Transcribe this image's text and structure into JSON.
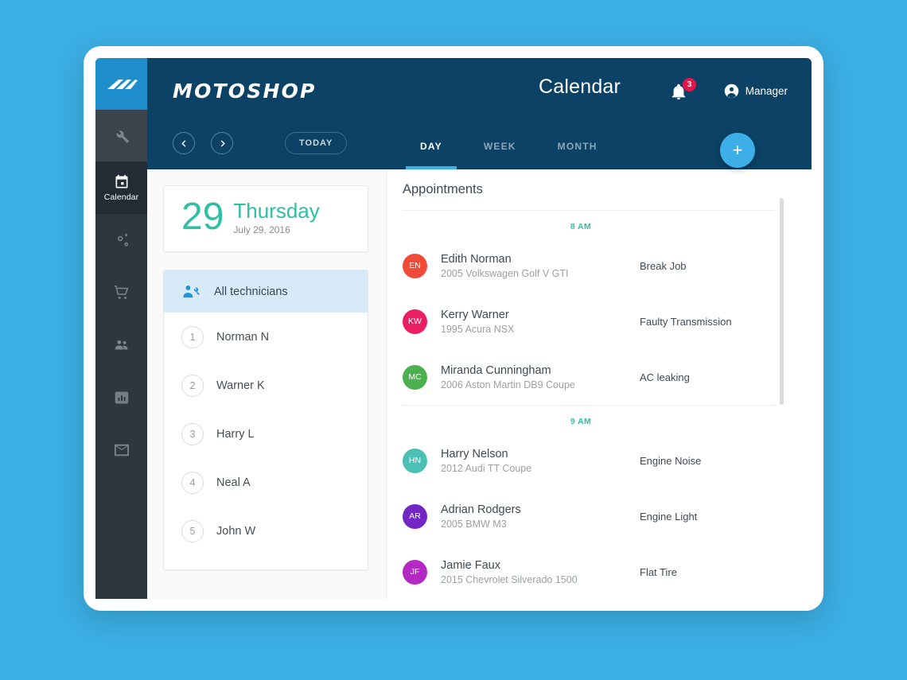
{
  "theme": {
    "page_background": "#3BAEE3",
    "header_background": "#0C4266",
    "rail_background": "#2C3740",
    "accent_blue": "#3CAEE8",
    "accent_teal": "#2EBFA5",
    "badge_red": "#E8154A",
    "selected_row": "#D6EAF7"
  },
  "brand": {
    "name": "MOTOSHOP",
    "logo_icon": "motoshop-logo-icon"
  },
  "header": {
    "title": "Calendar",
    "notifications": {
      "icon": "bell-icon",
      "count": "3"
    },
    "user": {
      "icon": "user-avatar-icon",
      "label": "Manager"
    }
  },
  "navbar": {
    "prev_icon": "chevron-left-icon",
    "next_icon": "chevron-right-icon",
    "today_label": "TODAY",
    "tabs": [
      {
        "label": "DAY",
        "active": true
      },
      {
        "label": "WEEK",
        "active": false
      },
      {
        "label": "MONTH",
        "active": false
      }
    ],
    "add_label": "+"
  },
  "rail": {
    "items": [
      {
        "icon": "wrench-icon",
        "label": "",
        "state": "hover"
      },
      {
        "icon": "calendar-icon",
        "label": "Calendar",
        "state": "active"
      },
      {
        "icon": "gears-icon",
        "label": "",
        "state": "normal"
      },
      {
        "icon": "shopping-cart-icon",
        "label": "",
        "state": "normal"
      },
      {
        "icon": "people-icon",
        "label": "",
        "state": "normal"
      },
      {
        "icon": "bar-chart-icon",
        "label": "",
        "state": "normal"
      },
      {
        "icon": "mail-icon",
        "label": "",
        "state": "normal"
      }
    ]
  },
  "date_card": {
    "day_number": "29",
    "day_name": "Thursday",
    "full_date": "July 29, 2016"
  },
  "technicians": {
    "all_label": "All technicians",
    "all_icon": "technician-icon",
    "list": [
      {
        "number": "1",
        "name": "Norman N"
      },
      {
        "number": "2",
        "name": "Warner K"
      },
      {
        "number": "3",
        "name": "Harry L"
      },
      {
        "number": "4",
        "name": "Neal A"
      },
      {
        "number": "5",
        "name": "John W"
      }
    ]
  },
  "appointments": {
    "title": "Appointments",
    "groups": [
      {
        "time": "8 AM",
        "items": [
          {
            "initials": "EN",
            "color": "#F04A38",
            "name": "Edith Norman",
            "vehicle": "2005 Volkswagen Golf V GTI",
            "job": "Break Job"
          },
          {
            "initials": "KW",
            "color": "#E91E63",
            "name": "Kerry Warner",
            "vehicle": "1995 Acura NSX",
            "job": "Faulty Transmission"
          },
          {
            "initials": "MC",
            "color": "#4CAF50",
            "name": "Miranda Cunningham",
            "vehicle": "2006 Aston Martin DB9 Coupe",
            "job": "AC leaking"
          }
        ]
      },
      {
        "time": "9 AM",
        "items": [
          {
            "initials": "HN",
            "color": "#4DC0B5",
            "name": "Harry Nelson",
            "vehicle": "2012 Audi TT Coupe",
            "job": "Engine Noise"
          },
          {
            "initials": "AR",
            "color": "#7226C4",
            "name": "Adrian Rodgers",
            "vehicle": "2005 BMW M3",
            "job": "Engine Light"
          },
          {
            "initials": "JF",
            "color": "#B429C4",
            "name": "Jamie Faux",
            "vehicle": "2015 Chevrolet Silverado 1500",
            "job": "Flat Tire"
          }
        ]
      }
    ]
  }
}
